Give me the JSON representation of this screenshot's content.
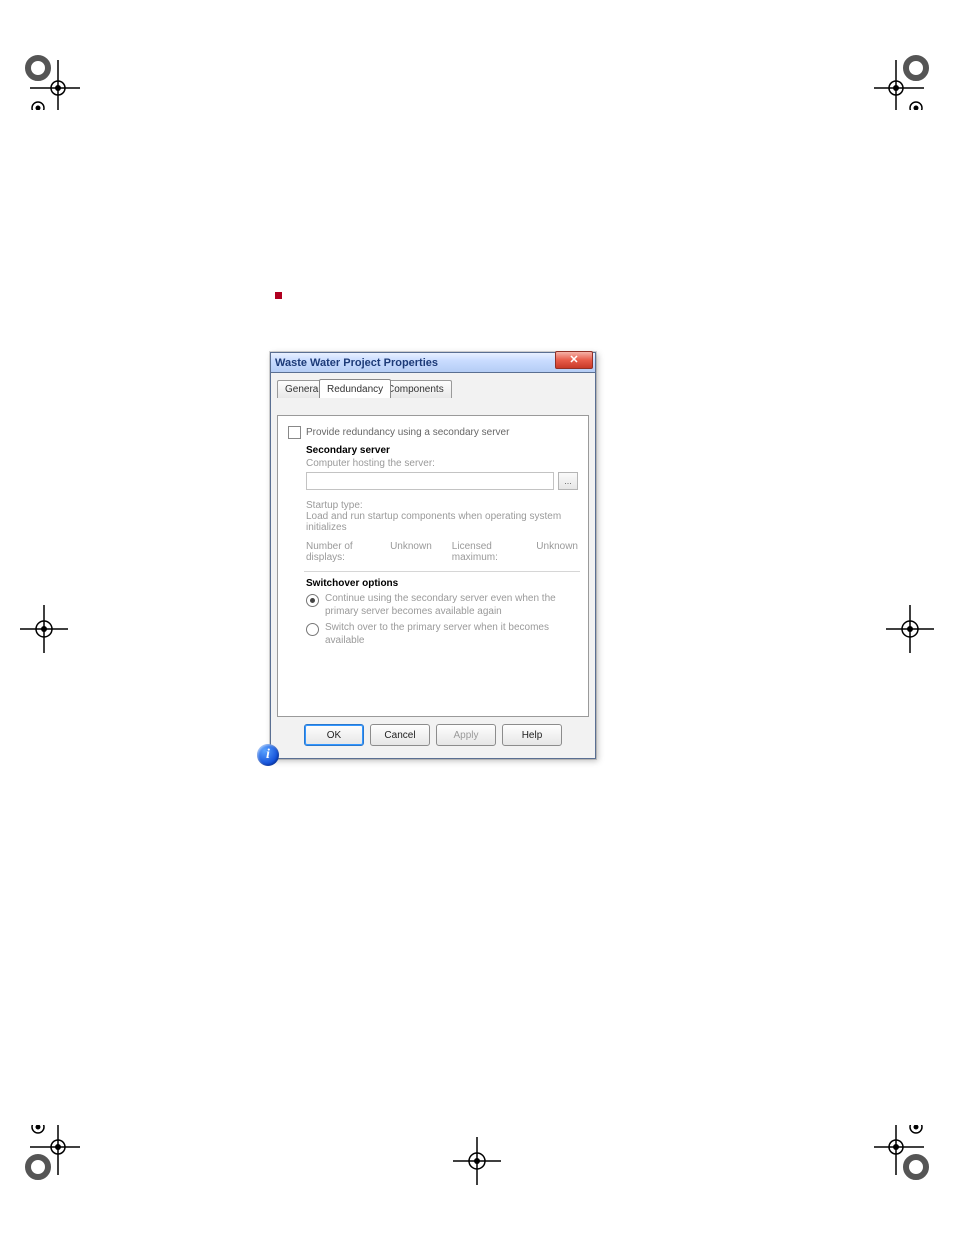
{
  "dialog": {
    "title": "Waste Water Project Properties",
    "tabs": {
      "general": "General",
      "redundancy": "Redundancy",
      "components": "Components"
    },
    "redundancy_check": "Provide redundancy using a secondary server",
    "secondary_server": {
      "heading": "Secondary server",
      "hosting_label": "Computer hosting the server:",
      "hosting_value": "",
      "browse": "...",
      "startup_label": "Startup type:",
      "startup_value": "Load and run startup components when operating system initializes",
      "displays_label": "Number of displays:",
      "displays_value": "Unknown",
      "licensed_label": "Licensed maximum:",
      "licensed_value": "Unknown"
    },
    "switchover": {
      "heading": "Switchover options",
      "opt1": "Continue using the secondary server even when the primary server becomes available again",
      "opt2": "Switch over to the primary server when it becomes available"
    },
    "buttons": {
      "ok": "OK",
      "cancel": "Cancel",
      "apply": "Apply",
      "help": "Help"
    }
  },
  "info_icon": {
    "glyph": "i"
  }
}
